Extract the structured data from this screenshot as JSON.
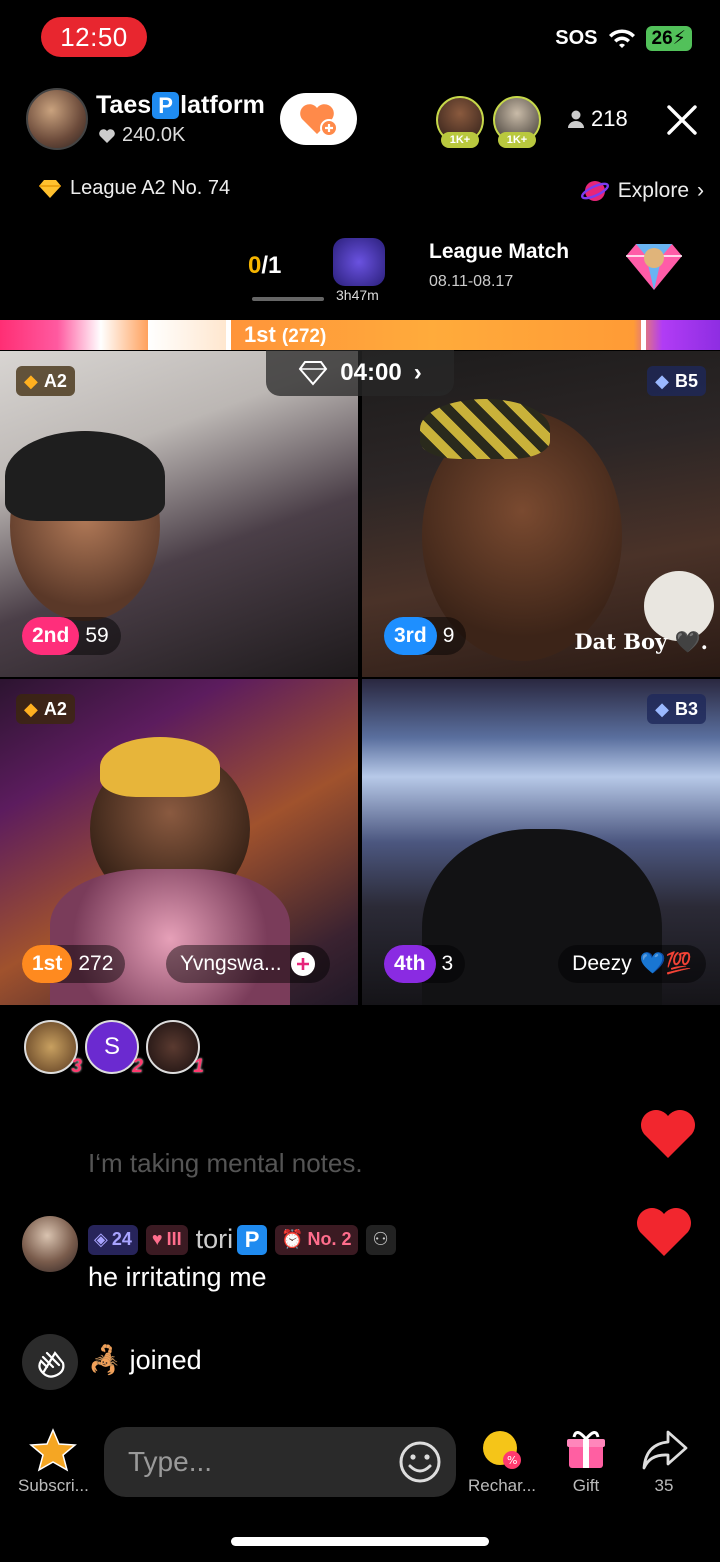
{
  "status": {
    "time": "12:50",
    "sos": "SOS",
    "battery": "26"
  },
  "host": {
    "name_pre": "Taes",
    "name_p": "P",
    "name_post": "latform",
    "likes": "240.0K"
  },
  "top_gifters": [
    {
      "tag": "1K+"
    },
    {
      "tag": "1K+"
    }
  ],
  "viewers": "218",
  "league": {
    "label": "League A2 No. 74"
  },
  "explore": {
    "label": "Explore"
  },
  "match": {
    "score_cur": "0",
    "score_total": "/1",
    "timer": "3h47m",
    "title": "League Match",
    "dates": "08.11-08.17"
  },
  "rank_bar": {
    "label": "1st",
    "points": "(272)"
  },
  "battle_timer": "04:00",
  "tiles": [
    {
      "tier": "A2",
      "rank": "2nd",
      "score": "59",
      "name": ""
    },
    {
      "tier": "B5",
      "rank": "3rd",
      "score": "9",
      "name": "Dat Boy"
    },
    {
      "tier": "A2",
      "rank": "1st",
      "score": "272",
      "name": "Yvngswa..."
    },
    {
      "tier": "B3",
      "rank": "4th",
      "score": "3",
      "name": "Deezy"
    }
  ],
  "rankers": [
    {
      "num": "3"
    },
    {
      "letter": "S",
      "num": "2"
    },
    {
      "num": "1"
    }
  ],
  "chat": {
    "faded": "I‘m taking mental notes.",
    "msg": {
      "level": "24",
      "fan_level": "III",
      "user_pre": "tori",
      "user_p": "P",
      "no_badge": "No. 2",
      "text": "he irritating me"
    },
    "joined": "joined"
  },
  "bottom": {
    "subscribe": "Subscri...",
    "placeholder": "Type...",
    "recharge": "Rechar...",
    "gift": "Gift",
    "share_count": "35"
  }
}
